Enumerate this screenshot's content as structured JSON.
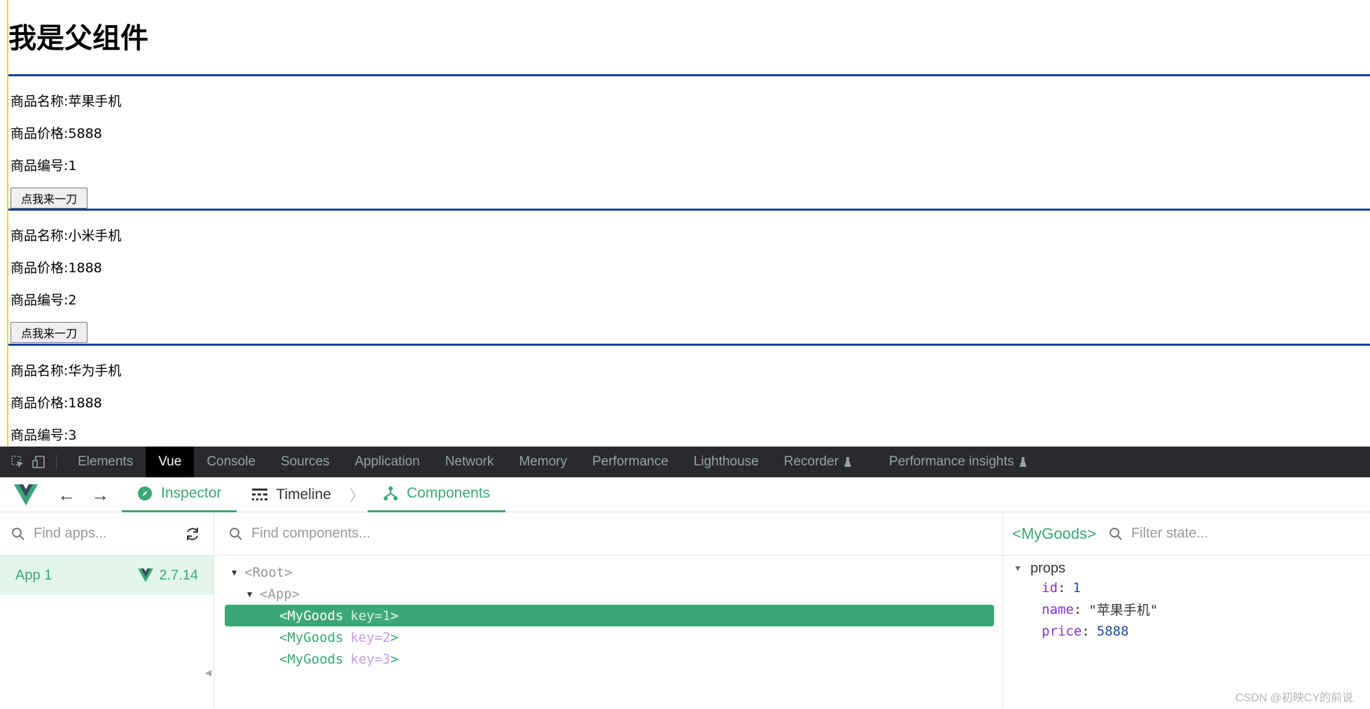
{
  "page": {
    "title": "我是父组件",
    "goods": [
      {
        "name_label": "商品名称:苹果手机",
        "price_label": "商品价格:5888",
        "id_label": "商品编号:1",
        "button_label": "点我来一刀"
      },
      {
        "name_label": "商品名称:小米手机",
        "price_label": "商品价格:1888",
        "id_label": "商品编号:2",
        "button_label": "点我来一刀"
      },
      {
        "name_label": "商品名称:华为手机",
        "price_label": "商品价格:1888",
        "id_label": "商品编号:3"
      }
    ]
  },
  "devtools": {
    "tabs": [
      "Elements",
      "Vue",
      "Console",
      "Sources",
      "Application",
      "Network",
      "Memory",
      "Performance",
      "Lighthouse",
      "Recorder",
      "Performance insights"
    ],
    "active_tab": "Vue"
  },
  "vue": {
    "header": {
      "inspector_label": "Inspector",
      "timeline_label": "Timeline",
      "components_label": "Components"
    },
    "apps": {
      "search_placeholder": "Find apps...",
      "app_name": "App 1",
      "app_version": "2.7.14"
    },
    "components": {
      "search_placeholder": "Find components...",
      "tree": {
        "root": "<Root>",
        "app": "<App>",
        "items": [
          {
            "open": "<MyGoods",
            "key_label": "key=1",
            "close": ">"
          },
          {
            "open": "<MyGoods",
            "key_label": "key=2",
            "close": ">"
          },
          {
            "open": "<MyGoods",
            "key_label": "key=3",
            "close": ">"
          }
        ]
      }
    },
    "state": {
      "component_name": "<MyGoods>",
      "filter_placeholder": "Filter state...",
      "section": "props",
      "props": [
        {
          "key": "id",
          "value": "1",
          "kind": "number"
        },
        {
          "key": "name",
          "value": "\"苹果手机\"",
          "kind": "string"
        },
        {
          "key": "price",
          "value": "5888",
          "kind": "number"
        }
      ]
    }
  },
  "watermark": "CSDN @初映CY的前说",
  "colors": {
    "vue_green": "#3ba776",
    "border_blue": "#1a3fa0",
    "devtools_dark": "#292a2d"
  }
}
